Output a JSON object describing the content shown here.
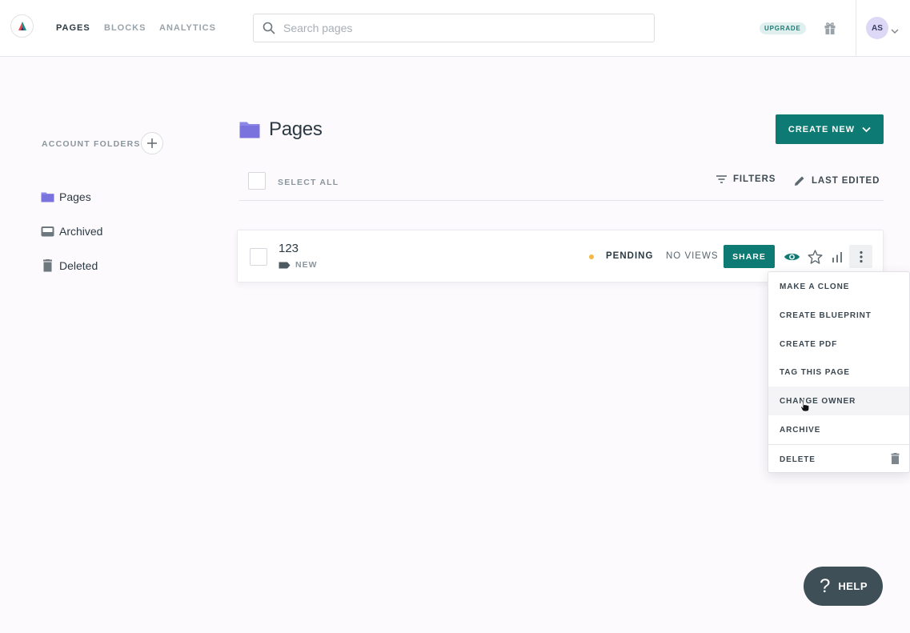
{
  "nav": {
    "links": [
      "PAGES",
      "BLOCKS",
      "ANALYTICS"
    ],
    "active_link": "PAGES",
    "search_placeholder": "Search pages",
    "search_value": "",
    "upgrade_label": "UPGRADE",
    "avatar_initials": "AS"
  },
  "sidebar": {
    "heading": "ACCOUNT FOLDERS",
    "items": [
      {
        "label": "Pages",
        "icon": "folder-icon"
      },
      {
        "label": "Archived",
        "icon": "archive-box-icon"
      },
      {
        "label": "Deleted",
        "icon": "trash-icon"
      }
    ]
  },
  "main": {
    "title": "Pages",
    "create_new_label": "CREATE NEW",
    "select_all_label": "SELECT ALL",
    "filters_label": "FILTERS",
    "sort_label": "LAST EDITED"
  },
  "page_card": {
    "name": "123",
    "tag": "NEW",
    "status": "PENDING",
    "views": "NO VIEWS",
    "share_label": "SHARE"
  },
  "menu": {
    "items": [
      "MAKE A CLONE",
      "CREATE BLUEPRINT",
      "CREATE PDF",
      "TAG THIS PAGE",
      "CHANGE OWNER",
      "ARCHIVE",
      "DELETE"
    ],
    "hovered_item": "CHANGE OWNER"
  },
  "help": {
    "glyph": "?",
    "label": "HELP"
  },
  "colors": {
    "accent": "#0d7a73",
    "folder": "#8c86e6",
    "status_pending": "#f5b942",
    "help_bg": "#3f4f58"
  }
}
